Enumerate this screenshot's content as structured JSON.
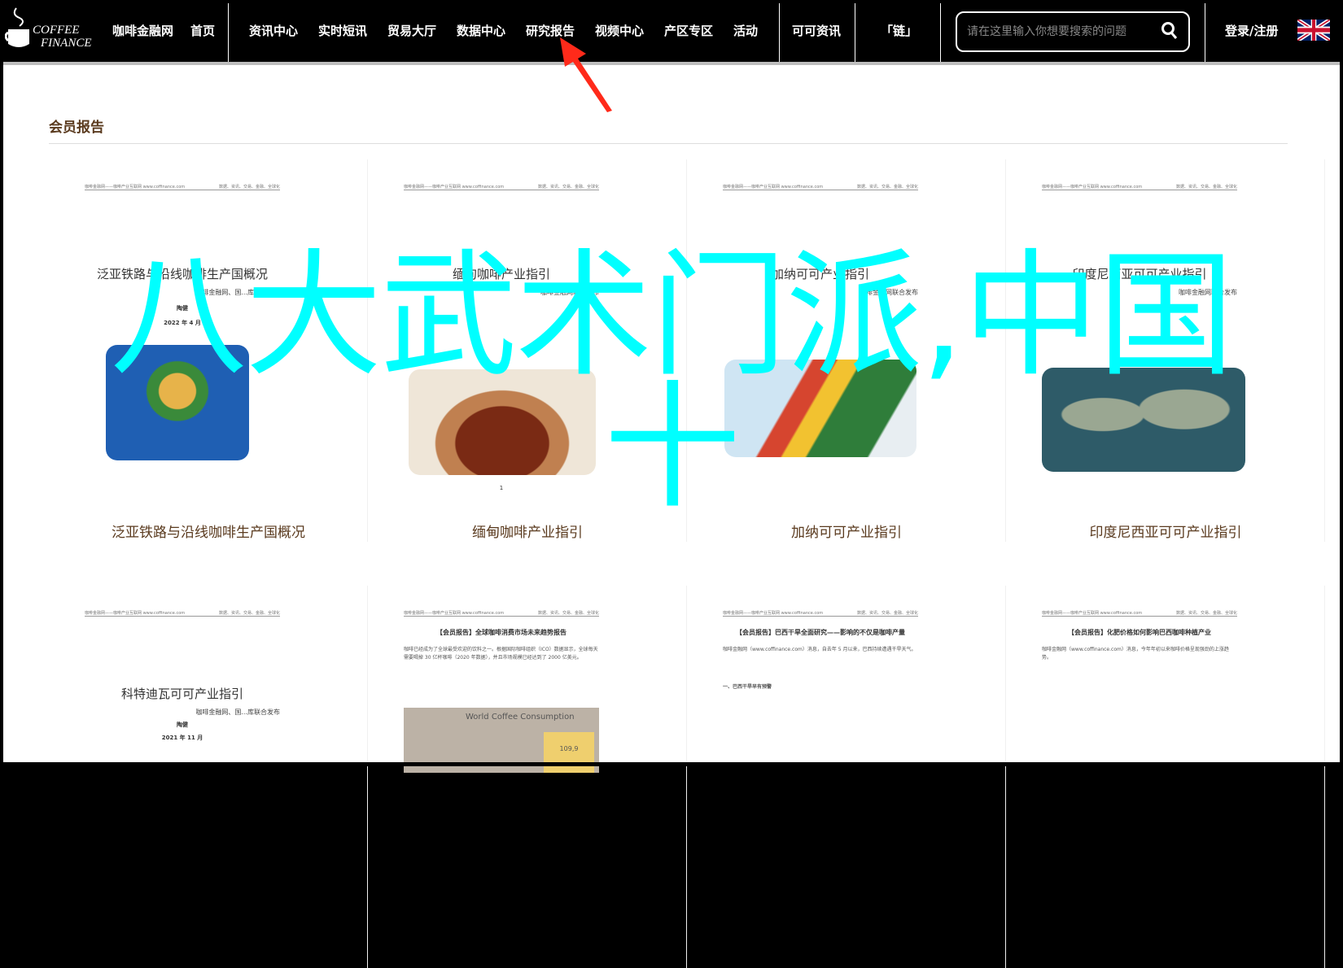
{
  "nav": {
    "logo_text": [
      "COFFEE",
      "FINANCE"
    ],
    "site_name": "咖啡金融网",
    "home": "首页",
    "items": [
      "资讯中心",
      "实时短讯",
      "贸易大厅",
      "数据中心",
      "研究报告",
      "视频中心",
      "产区专区",
      "活动"
    ],
    "cocoa": "可可资讯",
    "chain": "「链」",
    "search_placeholder": "请在这里输入你想要搜索的问题",
    "login": "登录/注册",
    "active_item": "研究报告"
  },
  "section": {
    "title": "会员报告"
  },
  "cards": [
    {
      "caption": "泛亚铁路与沿线咖啡生产国概况",
      "doc_title": "泛亚铁路与沿线咖啡生产国概况",
      "doc_sub": "咖啡金融网、国...库联合发布",
      "doc_author": "陶健",
      "doc_date": "2022 年 4 月",
      "image": "southeast-asia-map"
    },
    {
      "caption": "缅甸咖啡产业指引",
      "doc_title": "缅甸咖啡产业指引",
      "doc_sub": "咖啡金融网联合发布",
      "doc_page": "1",
      "image": "coffee-beans"
    },
    {
      "caption": "加纳可可产业指引",
      "doc_title": "加纳可可产业指引",
      "doc_sub": "咖啡金融网联合发布",
      "image": "ghana-flag-map"
    },
    {
      "caption": "印度尼西亚可可产业指引",
      "doc_title": "印度尼西亚可可产业指引",
      "doc_sub": "咖啡金融网联合发布",
      "image": "world-map"
    },
    {
      "doc_title": "科特迪瓦可可产业指引",
      "doc_sub": "咖啡金融网、国...库联合发布",
      "doc_author": "陶健",
      "doc_date": "2021 年 11 月"
    },
    {
      "doc_title": "【会员报告】全球咖啡消费市场未来趋势报告",
      "doc_para": "咖啡已经成为了全球最受欢迎的饮料之一。根据国际咖啡组织（ICO）数据显示，全球每天需要喝掉 30 亿杯咖啡（2020 年数据），并且市场规模已经达到了 2000 亿美元。",
      "chart_title": "World Coffee Consumption",
      "chart_value": "109,9"
    },
    {
      "doc_title": "【会员报告】巴西干旱全面研究——影响的不仅是咖啡产量",
      "doc_para": "咖啡金融网（www.coffinance.com）消息，自去年 5 月以来，巴西持续遭遇干旱天气。",
      "doc_heading": "一、巴西干旱早有预警"
    },
    {
      "doc_title": "【会员报告】化肥价格如何影响巴西咖啡种植产业",
      "doc_para": "咖啡金融网（www.coffinance.com）消息，今年年初以来咖啡价格呈现强劲的上涨趋势。"
    }
  ],
  "doc_header": {
    "left": "咖啡金融网——咖啡产业互联网 www.coffinance.com",
    "right": "数据、资讯、交易、金融、全球化"
  },
  "overlay": {
    "line1": "八大武术门派,中国",
    "line2": "十",
    "color": "#00ffff"
  },
  "colors": {
    "nav_bg": "#000000",
    "caption": "#5a3a1e",
    "arrow": "#ff2a1a"
  }
}
